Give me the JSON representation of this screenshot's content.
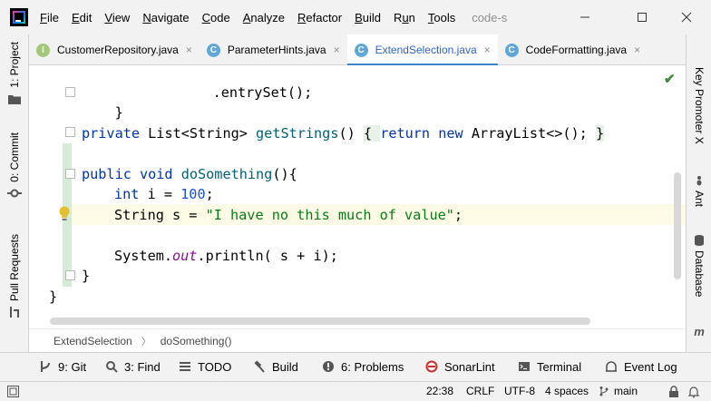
{
  "menu": {
    "items": [
      "File",
      "Edit",
      "View",
      "Navigate",
      "Code",
      "Analyze",
      "Refactor",
      "Build",
      "Run",
      "Tools"
    ],
    "project_title": "code-sample"
  },
  "left_toolwindows": [
    "1: Project",
    "0: Commit",
    "Pull Requests"
  ],
  "right_toolwindows": [
    "Key Promoter X",
    "Ant",
    "Database",
    "m"
  ],
  "tabs": [
    {
      "label": "CustomerRepository.java",
      "icon": "interface-icon",
      "close": "×"
    },
    {
      "label": "ParameterHints.java",
      "icon": "class-icon",
      "close": "×"
    },
    {
      "label": "ExtendSelection.java",
      "icon": "class-icon",
      "close": "×",
      "active": true
    },
    {
      "label": "CodeFormatting.java",
      "icon": "class-icon",
      "close": "×"
    }
  ],
  "code": {
    "l1": ".entrySet();",
    "l2": "}",
    "l3_kw": "private",
    "l3_type": " List<String> ",
    "l3_fn": "getStrings",
    "l3_paren": "() ",
    "l3_brace_open": "{ ",
    "l3_return": "return",
    "l3_sp": " ",
    "l3_new": "new",
    "l3_rest": " ArrayList<>(); ",
    "l3_brace_close": "}",
    "l4_kw": "public void",
    "l4_fn": " doSomething",
    "l4_rest": "(){",
    "l5_kw": "int",
    "l5_rest": " i = ",
    "l5_num": "100",
    "l5_semi": ";",
    "l6_start": "String s = ",
    "l6_str": "\"I have no this much of value\"",
    "l6_semi": ";",
    "l7_start": "System.",
    "l7_static": "out",
    "l7_rest": ".println( s + i);",
    "l8": "}",
    "l9": "}"
  },
  "breadcrumb": {
    "file": "ExtendSelection",
    "separator": "〉",
    "method": "doSomething()"
  },
  "tool_windows": [
    {
      "label": "9: Git",
      "icon": "git-icon"
    },
    {
      "label": "3: Find",
      "icon": "search-icon"
    },
    {
      "label": "TODO",
      "icon": "list-icon"
    },
    {
      "label": "Build",
      "icon": "hammer-icon"
    },
    {
      "label": "6: Problems",
      "icon": "problems-icon"
    },
    {
      "label": "SonarLint",
      "icon": "sonarlint-icon"
    },
    {
      "label": "Terminal",
      "icon": "terminal-icon"
    },
    {
      "label": "Event Log",
      "icon": "event-log-icon"
    }
  ],
  "status": {
    "position": "22:38",
    "line_ending": "CRLF",
    "encoding": "UTF-8",
    "indent": "4 spaces",
    "branch": "main"
  },
  "colors": {
    "keyword": "#0033b3",
    "function": "#00627a",
    "number": "#1750eb",
    "string": "#067d17",
    "static_field": "#871094",
    "active_tab_underline": "#4083c9"
  }
}
